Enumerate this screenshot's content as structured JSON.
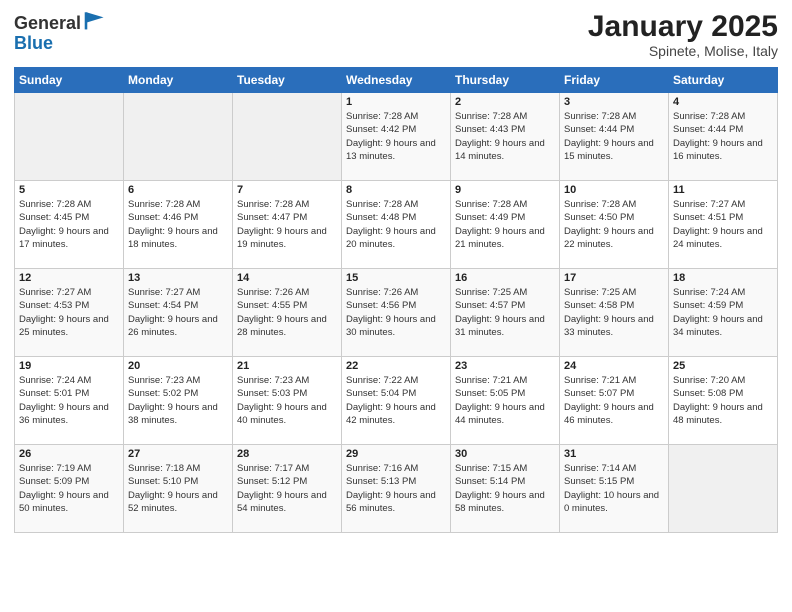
{
  "header": {
    "logo_general": "General",
    "logo_blue": "Blue",
    "title": "January 2025",
    "subtitle": "Spinete, Molise, Italy"
  },
  "calendar": {
    "days_of_week": [
      "Sunday",
      "Monday",
      "Tuesday",
      "Wednesday",
      "Thursday",
      "Friday",
      "Saturday"
    ],
    "weeks": [
      [
        {
          "day": "",
          "info": ""
        },
        {
          "day": "",
          "info": ""
        },
        {
          "day": "",
          "info": ""
        },
        {
          "day": "1",
          "info": "Sunrise: 7:28 AM\nSunset: 4:42 PM\nDaylight: 9 hours and 13 minutes."
        },
        {
          "day": "2",
          "info": "Sunrise: 7:28 AM\nSunset: 4:43 PM\nDaylight: 9 hours and 14 minutes."
        },
        {
          "day": "3",
          "info": "Sunrise: 7:28 AM\nSunset: 4:44 PM\nDaylight: 9 hours and 15 minutes."
        },
        {
          "day": "4",
          "info": "Sunrise: 7:28 AM\nSunset: 4:44 PM\nDaylight: 9 hours and 16 minutes."
        }
      ],
      [
        {
          "day": "5",
          "info": "Sunrise: 7:28 AM\nSunset: 4:45 PM\nDaylight: 9 hours and 17 minutes."
        },
        {
          "day": "6",
          "info": "Sunrise: 7:28 AM\nSunset: 4:46 PM\nDaylight: 9 hours and 18 minutes."
        },
        {
          "day": "7",
          "info": "Sunrise: 7:28 AM\nSunset: 4:47 PM\nDaylight: 9 hours and 19 minutes."
        },
        {
          "day": "8",
          "info": "Sunrise: 7:28 AM\nSunset: 4:48 PM\nDaylight: 9 hours and 20 minutes."
        },
        {
          "day": "9",
          "info": "Sunrise: 7:28 AM\nSunset: 4:49 PM\nDaylight: 9 hours and 21 minutes."
        },
        {
          "day": "10",
          "info": "Sunrise: 7:28 AM\nSunset: 4:50 PM\nDaylight: 9 hours and 22 minutes."
        },
        {
          "day": "11",
          "info": "Sunrise: 7:27 AM\nSunset: 4:51 PM\nDaylight: 9 hours and 24 minutes."
        }
      ],
      [
        {
          "day": "12",
          "info": "Sunrise: 7:27 AM\nSunset: 4:53 PM\nDaylight: 9 hours and 25 minutes."
        },
        {
          "day": "13",
          "info": "Sunrise: 7:27 AM\nSunset: 4:54 PM\nDaylight: 9 hours and 26 minutes."
        },
        {
          "day": "14",
          "info": "Sunrise: 7:26 AM\nSunset: 4:55 PM\nDaylight: 9 hours and 28 minutes."
        },
        {
          "day": "15",
          "info": "Sunrise: 7:26 AM\nSunset: 4:56 PM\nDaylight: 9 hours and 30 minutes."
        },
        {
          "day": "16",
          "info": "Sunrise: 7:25 AM\nSunset: 4:57 PM\nDaylight: 9 hours and 31 minutes."
        },
        {
          "day": "17",
          "info": "Sunrise: 7:25 AM\nSunset: 4:58 PM\nDaylight: 9 hours and 33 minutes."
        },
        {
          "day": "18",
          "info": "Sunrise: 7:24 AM\nSunset: 4:59 PM\nDaylight: 9 hours and 34 minutes."
        }
      ],
      [
        {
          "day": "19",
          "info": "Sunrise: 7:24 AM\nSunset: 5:01 PM\nDaylight: 9 hours and 36 minutes."
        },
        {
          "day": "20",
          "info": "Sunrise: 7:23 AM\nSunset: 5:02 PM\nDaylight: 9 hours and 38 minutes."
        },
        {
          "day": "21",
          "info": "Sunrise: 7:23 AM\nSunset: 5:03 PM\nDaylight: 9 hours and 40 minutes."
        },
        {
          "day": "22",
          "info": "Sunrise: 7:22 AM\nSunset: 5:04 PM\nDaylight: 9 hours and 42 minutes."
        },
        {
          "day": "23",
          "info": "Sunrise: 7:21 AM\nSunset: 5:05 PM\nDaylight: 9 hours and 44 minutes."
        },
        {
          "day": "24",
          "info": "Sunrise: 7:21 AM\nSunset: 5:07 PM\nDaylight: 9 hours and 46 minutes."
        },
        {
          "day": "25",
          "info": "Sunrise: 7:20 AM\nSunset: 5:08 PM\nDaylight: 9 hours and 48 minutes."
        }
      ],
      [
        {
          "day": "26",
          "info": "Sunrise: 7:19 AM\nSunset: 5:09 PM\nDaylight: 9 hours and 50 minutes."
        },
        {
          "day": "27",
          "info": "Sunrise: 7:18 AM\nSunset: 5:10 PM\nDaylight: 9 hours and 52 minutes."
        },
        {
          "day": "28",
          "info": "Sunrise: 7:17 AM\nSunset: 5:12 PM\nDaylight: 9 hours and 54 minutes."
        },
        {
          "day": "29",
          "info": "Sunrise: 7:16 AM\nSunset: 5:13 PM\nDaylight: 9 hours and 56 minutes."
        },
        {
          "day": "30",
          "info": "Sunrise: 7:15 AM\nSunset: 5:14 PM\nDaylight: 9 hours and 58 minutes."
        },
        {
          "day": "31",
          "info": "Sunrise: 7:14 AM\nSunset: 5:15 PM\nDaylight: 10 hours and 0 minutes."
        },
        {
          "day": "",
          "info": ""
        }
      ]
    ]
  }
}
